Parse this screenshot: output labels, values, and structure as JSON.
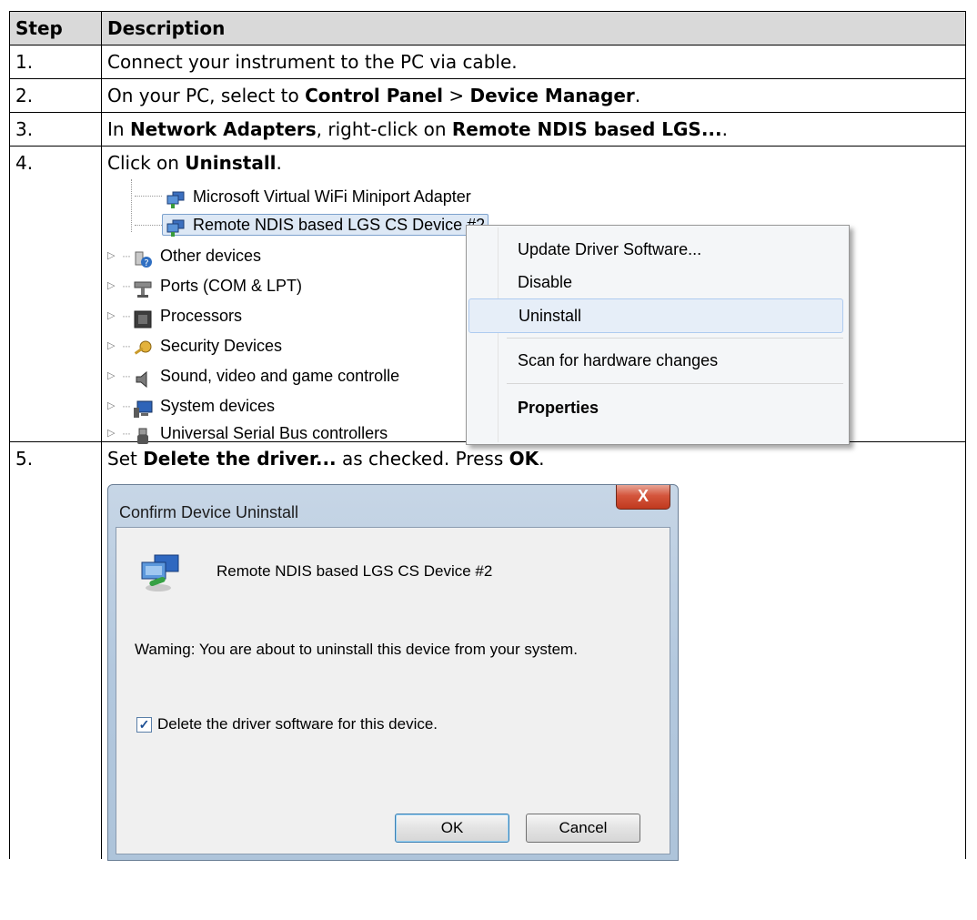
{
  "table": {
    "header": {
      "step": "Step",
      "description": "Description"
    },
    "steps": [
      {
        "num": "1.",
        "parts": [
          "Connect your instrument to the PC via cable."
        ]
      },
      {
        "num": "2.",
        "parts": [
          "On your PC, select to ",
          "Control Panel",
          " > ",
          "Device Manager",
          "."
        ]
      },
      {
        "num": "3.",
        "parts": [
          "In ",
          "Network Adapters",
          ", right-click on ",
          "Remote NDIS based LGS...",
          "."
        ]
      },
      {
        "num": "4.",
        "parts": [
          "Click on ",
          "Uninstall",
          "."
        ]
      },
      {
        "num": "5.",
        "parts": [
          "Set ",
          "Delete the driver...",
          " as checked. Press ",
          "OK",
          "."
        ]
      }
    ]
  },
  "device_manager": {
    "tree_items": [
      "Microsoft Virtual WiFi Miniport Adapter",
      "Remote NDIS based LGS CS Device #2",
      "Other devices",
      "Ports (COM & LPT)",
      "Processors",
      "Security Devices",
      "Sound, video and game controlle",
      "System devices",
      "Universal Serial Bus controllers"
    ],
    "context_menu": [
      "Update Driver Software...",
      "Disable",
      "Uninstall",
      "Scan for hardware changes",
      "Properties"
    ]
  },
  "dialog": {
    "title": "Confirm Device Uninstall",
    "close": "X",
    "device_name": "Remote NDIS based LGS CS Device #2",
    "warning": "Waming: You are about to uninstall this device from your system.",
    "checkbox_label": "Delete the driver software for this device.",
    "checkbox_checked": true,
    "ok": "OK",
    "cancel": "Cancel"
  }
}
